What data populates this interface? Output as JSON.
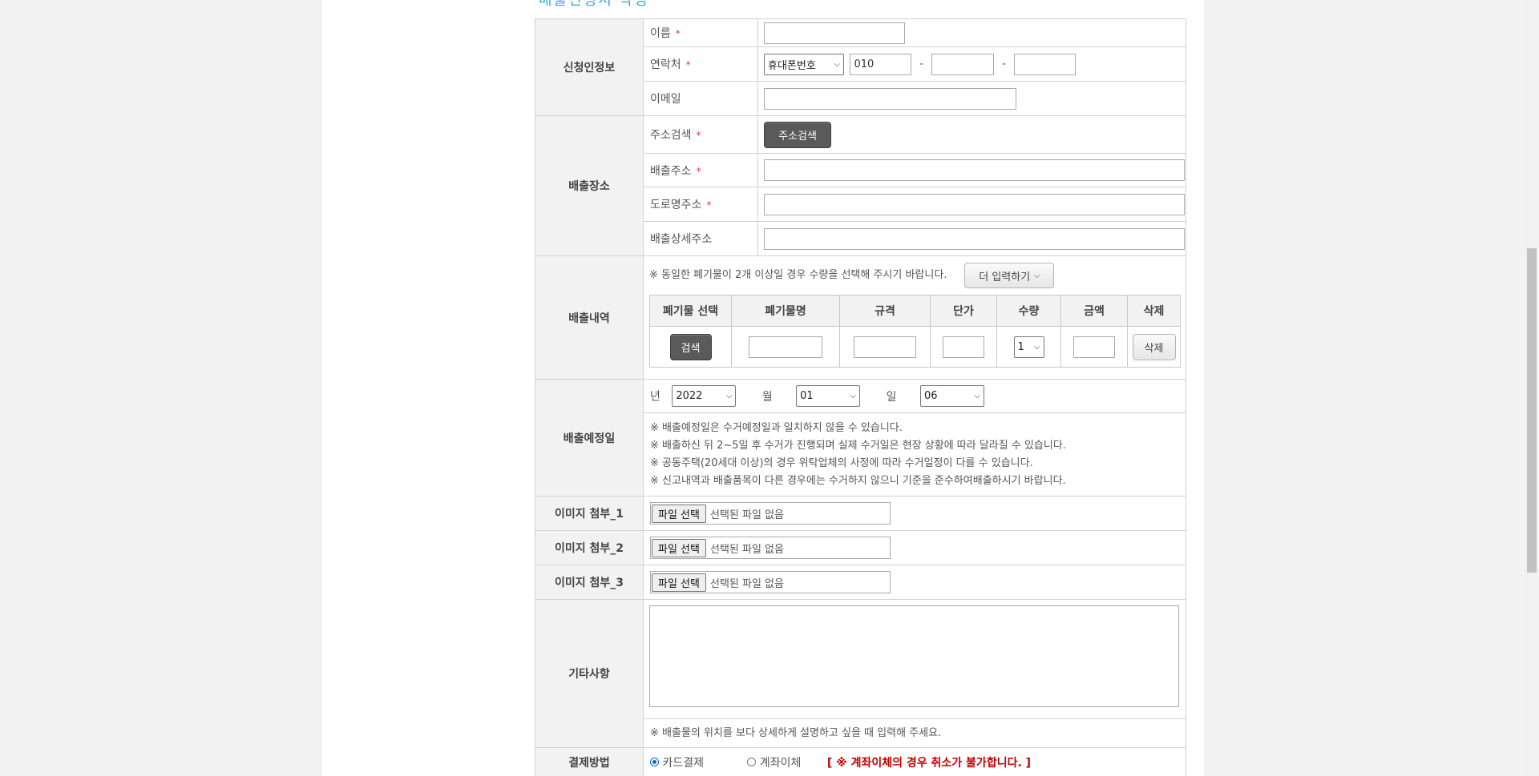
{
  "heading_fragment": "배출신청서 작성",
  "applicant": {
    "section": "신청인정보",
    "name_label": "이름",
    "contact_label": "연락처",
    "phone_type": "휴대폰번호",
    "phone_prefix": "010",
    "email_label": "이메일",
    "required_mark": "*"
  },
  "location": {
    "section": "배출장소",
    "search_label": "주소검색",
    "search_button": "주소검색",
    "address_label": "배출주소",
    "road_label": "도로명주소",
    "detail_label": "배출상세주소"
  },
  "waste": {
    "section": "배출내역",
    "notice": "※ 동일한 폐기물이 2개 이상일 경우 수량을 선택해 주시기 바랍니다.",
    "more_button": "더 입력하기",
    "columns": [
      "폐기물 선택",
      "폐기물명",
      "규격",
      "단가",
      "수량",
      "금액",
      "삭제"
    ],
    "search_button": "검색",
    "quantity": "1",
    "delete_button": "삭제"
  },
  "schedule": {
    "section": "배출예정일",
    "year_label": "년",
    "year": "2022",
    "month_label": "월",
    "month": "01",
    "day_label": "일",
    "day": "06",
    "notes": [
      "※ 배출예정일은 수거예정일과 일치하지 않을 수 있습니다.",
      "※ 배출하신 뒤 2~5일 후 수거가 진행되며 실제 수거일은 현장 상황에 따라 달라질 수 있습니다.",
      "※ 공동주택(20세대 이상)의 경우 위탁업체의 사정에 따라 수거일정이 다를 수 있습니다.",
      "※ 신고내역과 배출품목이 다른 경우에는 수거하지 않으니 기준을 준수하여배출하시기 바랍니다."
    ]
  },
  "attachments": [
    {
      "label": "이미지 첨부_1",
      "button": "파일 선택",
      "status": "선택된 파일 없음"
    },
    {
      "label": "이미지 첨부_2",
      "button": "파일 선택",
      "status": "선택된 파일 없음"
    },
    {
      "label": "이미지 첨부_3",
      "button": "파일 선택",
      "status": "선택된 파일 없음"
    }
  ],
  "etc": {
    "section": "기타사항",
    "notice": "※ 배출물의 위치를 보다 상세하게 설명하고 싶을 때 입력해 주세요."
  },
  "payment": {
    "section": "결제방법",
    "card": "카드결제",
    "transfer": "계좌이체",
    "warning": "[ ※ 계좌이체의 경우 취소가 불가합니다. ]"
  }
}
